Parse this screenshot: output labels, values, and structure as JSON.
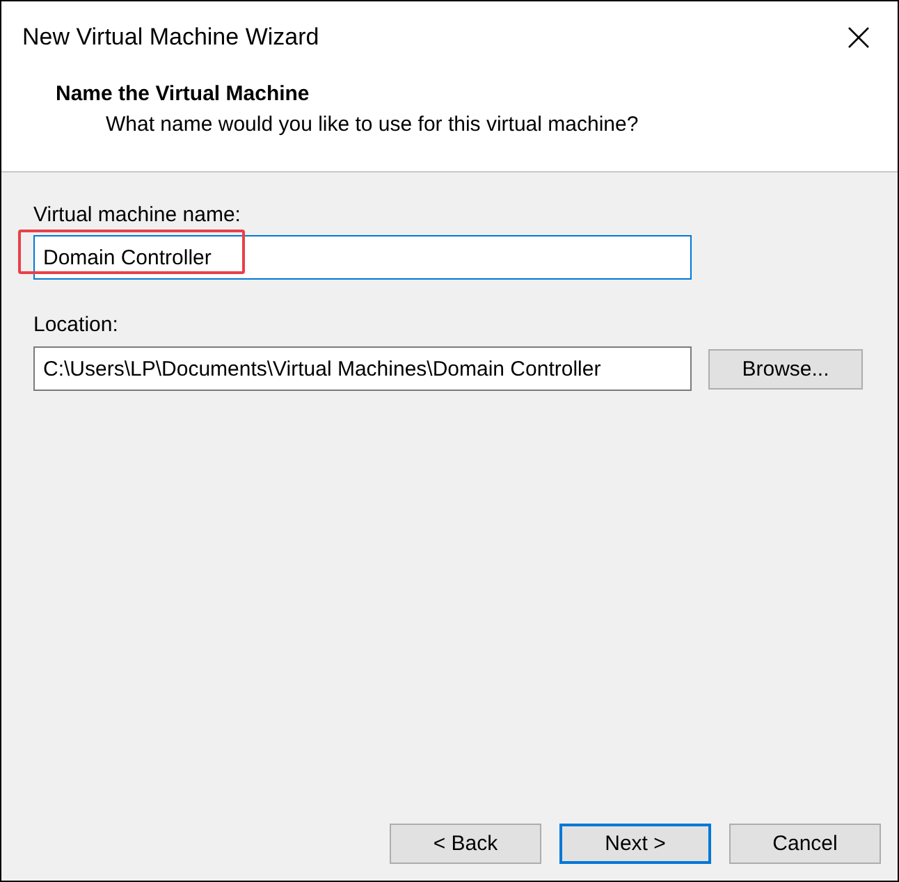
{
  "window": {
    "title": "New Virtual Machine Wizard"
  },
  "header": {
    "title": "Name the Virtual Machine",
    "subtitle": "What name would you like to use for this virtual machine?"
  },
  "name_field": {
    "label": "Virtual machine name:",
    "value": "Domain Controller",
    "highlighted": true
  },
  "location_field": {
    "label": "Location:",
    "value": "C:\\Users\\LP\\Documents\\Virtual Machines\\Domain Controller"
  },
  "browse_button": "Browse...",
  "buttons": [
    {
      "label": "< Back",
      "default": false
    },
    {
      "label": "Next >",
      "default": true
    },
    {
      "label": "Cancel",
      "default": false
    }
  ]
}
